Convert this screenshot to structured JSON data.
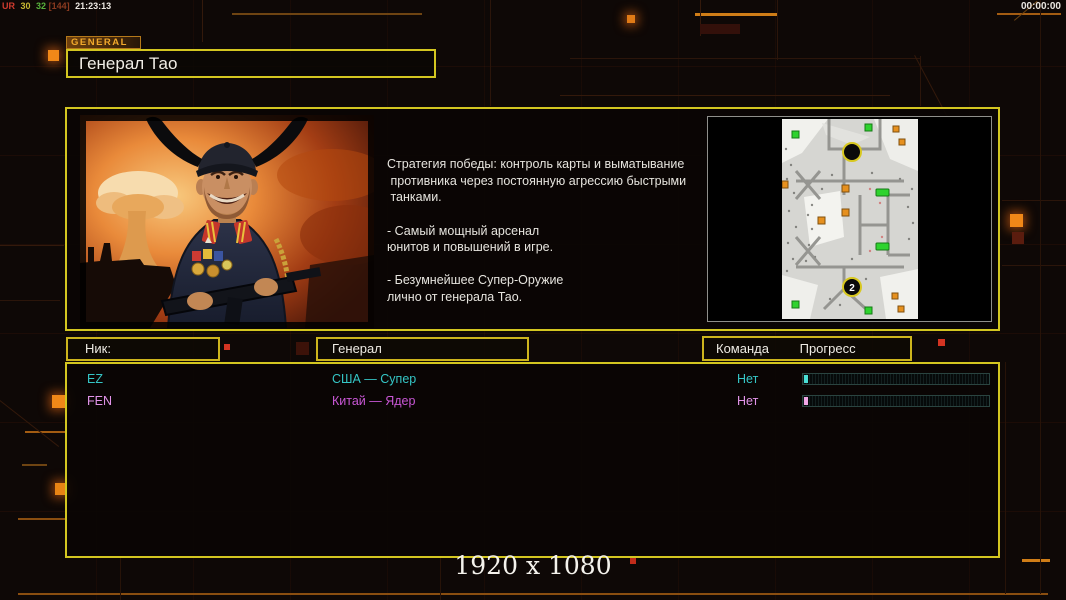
{
  "hud": {
    "perf_stats": {
      "label_ur": "UR",
      "value_30": "30",
      "value_32": "32",
      "value_bracket": "[144]",
      "time": "21:23:13"
    },
    "match_clock": "00:00:00",
    "resolution_label": "1920 x 1080"
  },
  "header": {
    "tab_label": "GENERAL",
    "general_name": "Генерал Тао"
  },
  "general_panel": {
    "description": "Стратегия победы: контроль карты и выматывание\n противника через постоянную агрессию быстрыми\n танками.\n\n- Самый мощный арсенал\nюнитов и повышений в игре.\n\n- Безумнейшее Супер-Оружие\nлично от генерала Тао.",
    "minimap": {
      "start_position_2_label": "2"
    }
  },
  "players": {
    "columns": {
      "nick": "Ник:",
      "general": "Генерал",
      "team": "Команда",
      "progress": "Прогресс"
    },
    "rows": [
      {
        "nick": "EZ",
        "general": "США — Супер",
        "team": "Нет",
        "progress_percent": 2,
        "color": "#35c6c6",
        "general_color": "#35c6c6",
        "bar_color": "#4adfd6"
      },
      {
        "nick": "FEN",
        "general": "Китай — Ядер",
        "team": "Нет",
        "progress_percent": 2,
        "color": "#e294ea",
        "general_color": "#c957d6",
        "bar_color": "#f2a6e6"
      }
    ]
  },
  "colors": {
    "accent_yellow": "#d3c620",
    "accent_orange": "#e8821c"
  }
}
